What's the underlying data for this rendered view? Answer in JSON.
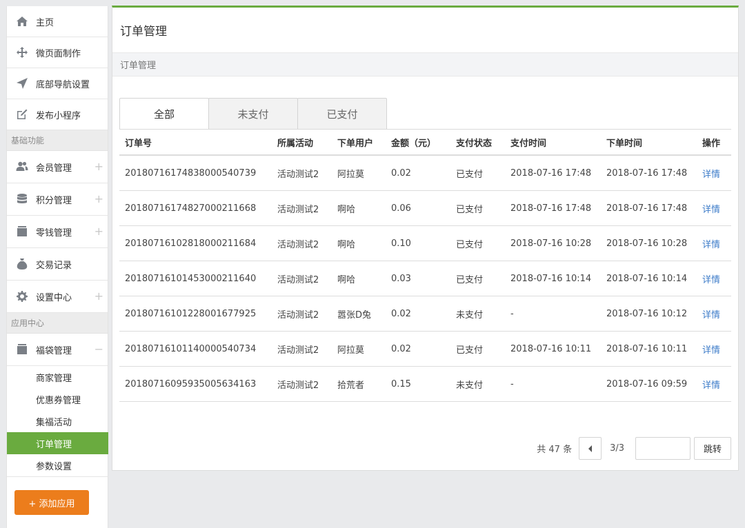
{
  "sidebar": {
    "top_items": [
      {
        "label": "主页",
        "icon": "home-icon"
      },
      {
        "label": "微页面制作",
        "icon": "move-icon"
      },
      {
        "label": "底部导航设置",
        "icon": "navigation-arrow-icon"
      },
      {
        "label": "发布小程序",
        "icon": "edit-icon"
      }
    ],
    "section_basic": "基础功能",
    "basic_items": [
      {
        "label": "会员管理",
        "icon": "users-icon",
        "toggle": "+"
      },
      {
        "label": "积分管理",
        "icon": "database-icon",
        "toggle": "+"
      },
      {
        "label": "零钱管理",
        "icon": "wallet-icon",
        "toggle": "+"
      },
      {
        "label": "交易记录",
        "icon": "money-bag-icon"
      },
      {
        "label": "设置中心",
        "icon": "gear-icon",
        "toggle": "+"
      }
    ],
    "section_apps": "应用中心",
    "app_group": {
      "label": "福袋管理",
      "icon": "bag-icon",
      "toggle": "−"
    },
    "app_sub_items": [
      "商家管理",
      "优惠券管理",
      "集福活动",
      "订单管理",
      "参数设置"
    ],
    "active_sub_index": 3,
    "add_app_label": "+ 添加应用"
  },
  "main": {
    "title": "订单管理",
    "breadcrumb": "订单管理",
    "tabs": [
      "全部",
      "未支付",
      "已支付"
    ],
    "active_tab": 0,
    "columns": [
      "订单号",
      "所属活动",
      "下单用户",
      "金额（元）",
      "支付状态",
      "支付时间",
      "下单时间",
      "操作"
    ],
    "rows": [
      [
        "20180716174838000540739",
        "活动测试2",
        "阿拉莫",
        "0.02",
        "已支付",
        "2018-07-16 17:48",
        "2018-07-16 17:48",
        "详情"
      ],
      [
        "20180716174827000211668",
        "活动测试2",
        "啊哈",
        "0.06",
        "已支付",
        "2018-07-16 17:48",
        "2018-07-16 17:48",
        "详情"
      ],
      [
        "20180716102818000211684",
        "活动测试2",
        "啊哈",
        "0.10",
        "已支付",
        "2018-07-16 10:28",
        "2018-07-16 10:28",
        "详情"
      ],
      [
        "20180716101453000211640",
        "活动测试2",
        "啊哈",
        "0.03",
        "已支付",
        "2018-07-16 10:14",
        "2018-07-16 10:14",
        "详情"
      ],
      [
        "20180716101228001677925",
        "活动测试2",
        "嚣张D兔",
        "0.02",
        "未支付",
        "-",
        "2018-07-16 10:12",
        "详情"
      ],
      [
        "20180716101140000540734",
        "活动测试2",
        "阿拉莫",
        "0.02",
        "已支付",
        "2018-07-16 10:11",
        "2018-07-16 10:11",
        "详情"
      ],
      [
        "20180716095935005634163",
        "活动测试2",
        "拾荒者",
        "0.15",
        "未支付",
        "-",
        "2018-07-16 09:59",
        "详情"
      ]
    ],
    "pager": {
      "total": "共 47 条",
      "page": "3/3",
      "input_value": "",
      "go_label": "跳转"
    }
  },
  "colors": {
    "accent_green": "#6aab3f",
    "accent_orange": "#ec7d1c",
    "link_blue": "#3d7cc9"
  }
}
